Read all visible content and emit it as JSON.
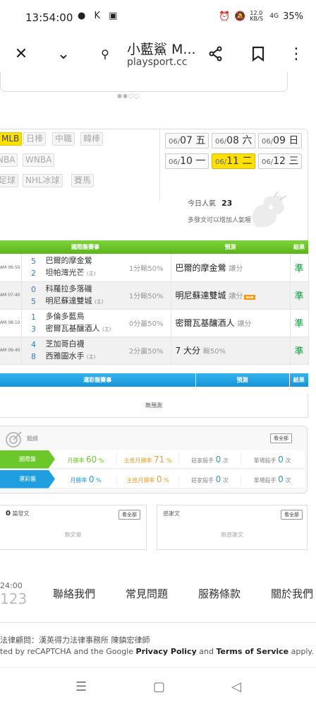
{
  "status": {
    "time": "13:54:00",
    "notif": "● K ▣",
    "net": "12.0 KB/S",
    "signal": "4G",
    "battery": "35%"
  },
  "browser": {
    "title": "小藍鯊 M...",
    "url": "playsport.cc"
  },
  "leagues": [
    "MLB",
    "日棒",
    "中職",
    "韓棒",
    "NBA",
    "WNBA",
    "足球",
    "NHL冰球",
    "賽馬"
  ],
  "dates": [
    {
      "md": "06/",
      "d": "07",
      "w": "五"
    },
    {
      "md": "06/",
      "d": "08",
      "w": "六"
    },
    {
      "md": "06/",
      "d": "09",
      "w": "日"
    },
    {
      "md": "06/",
      "d": "10",
      "w": "一"
    },
    {
      "md": "06/",
      "d": "11",
      "w": "二"
    },
    {
      "md": "06/",
      "d": "12",
      "w": "三"
    }
  ],
  "popularity": {
    "label": "今日人氣",
    "value": "23",
    "tip": "多發文可以增加人氣喔"
  },
  "intl_table": {
    "header": [
      "國際盤賽事",
      "預測",
      "結果"
    ],
    "rows": [
      {
        "time": "AM 06:50",
        "s1": "5",
        "t1": "巴爾的摩金鶯",
        "s2": "2",
        "t2": "坦帕灣光芒",
        "home": "(主)",
        "hc1": "1分輸50%",
        "hc2": "",
        "pick": "巴爾的摩金鶯",
        "ptype": "讓分",
        "res": "準"
      },
      {
        "time": "AM 07:40",
        "s1": "0",
        "t1": "科羅拉多落磯",
        "s2": "5",
        "t2": "明尼蘇達雙城",
        "home": "(主)",
        "hc1": "",
        "hc2": "1分輸50%",
        "pick": "明尼蘇達雙城",
        "ptype": "讓分",
        "res": "準"
      },
      {
        "time": "AM 08:10",
        "s1": "1",
        "t1": "多倫多藍鳥",
        "s2": "3",
        "t2": "密爾瓦基釀酒人",
        "home": "(主)",
        "hc1": "",
        "hc2": "0分贏50%",
        "pick": "密爾瓦基釀酒人",
        "ptype": "讓分",
        "res": "準"
      },
      {
        "time": "AM 09:40",
        "s1": "4",
        "t1": "芝加哥白襪",
        "s2": "8",
        "t2": "西雅圖水手",
        "home": "(主)",
        "hc1": "",
        "hc2": "2分贏50%",
        "pick": "7 大分",
        "ptype": "輸50%",
        "res": "準"
      }
    ]
  },
  "lottery_table": {
    "header": [
      "運彩盤賽事",
      "預測",
      "結果"
    ],
    "empty": "無預測"
  },
  "record": {
    "label": "戰績",
    "btn": "看全部",
    "rows": [
      {
        "tag": "國際盤",
        "c1l": "月勝率",
        "c1v": "60",
        "c1u": "%",
        "c2l": "主推月勝率",
        "c2v": "71",
        "c2u": "%",
        "c3l": "莊家殺手",
        "c3v": "0",
        "c3u": "次",
        "c4l": "單場殺手",
        "c4v": "0",
        "c4u": "次"
      },
      {
        "tag": "運彩盤",
        "c1l": "月勝率",
        "c1v": "0",
        "c1u": "%",
        "c2l": "主推月勝率",
        "c2v": "0",
        "c2u": "%",
        "c3l": "莊家殺手",
        "c3v": "0",
        "c3u": "次",
        "c4l": "單場殺手",
        "c4v": "0",
        "c4u": "次"
      }
    ]
  },
  "posts": {
    "count": "0",
    "label": "篇發文",
    "btn": "看全部",
    "empty": "無文章"
  },
  "thanks": {
    "label": "感謝文",
    "btn": "看全部",
    "empty": "無感謝文"
  },
  "footer": {
    "time": "24:00",
    "num": "123",
    "links": [
      "聯絡我們",
      "常見問題",
      "服務條款",
      "關於我們"
    ],
    "law": "法律顧問：漢英得力法律事務所 陳鎮宏律師",
    "cap_a": "ted by reCAPTCHA and the Google ",
    "cap_b": "Privacy Policy",
    "cap_c": " and ",
    "cap_d": "Terms of Service",
    "cap_e": " apply."
  }
}
